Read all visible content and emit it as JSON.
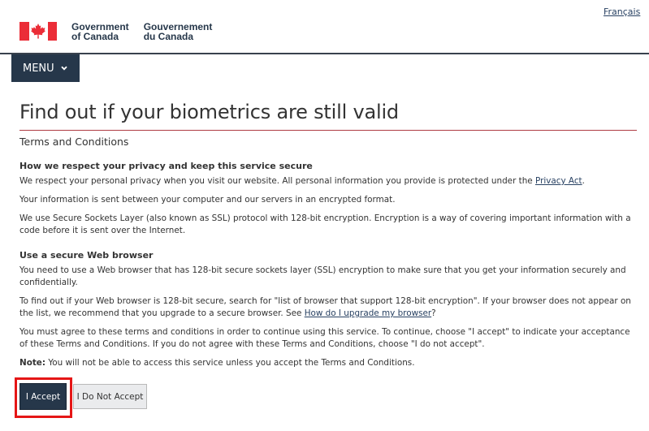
{
  "header": {
    "language_link": "Français",
    "signature": {
      "en_line1": "Government",
      "en_line2": "of Canada",
      "fr_line1": "Gouvernement",
      "fr_line2": "du Canada"
    },
    "menu_label": "MENU"
  },
  "main": {
    "title": "Find out if your biometrics are still valid",
    "section_heading": "Terms and Conditions",
    "privacy": {
      "heading": "How we respect your privacy and keep this service secure",
      "p1_pre": "We respect your personal privacy when you visit our website.  All personal information you provide is protected under the ",
      "p1_link": "Privacy Act",
      "p1_post": ".",
      "p2": "Your information is sent between your computer and our servers in an encrypted format.",
      "p3": "We use Secure Sockets Layer (also known as SSL) protocol with 128-bit encryption. Encryption is a way of covering important information with a code before it is sent over the Internet."
    },
    "browser": {
      "heading": "Use a secure Web browser",
      "p1": "You need to use a Web browser that has 128-bit secure sockets layer (SSL) encryption to make sure that you get your information securely and confidentially.",
      "p2_pre": "To find out if your Web browser is 128-bit secure, search for \"list of browser that support 128-bit encryption\". If your browser does not appear on the list, we recommend that you upgrade to a secure browser.  See ",
      "p2_link": "How do I upgrade my browser",
      "p2_post": "?",
      "p3": "You must agree to these terms and conditions in order to continue using this service. To continue, choose \"I accept\" to indicate your acceptance of these Terms and Conditions. If you do not agree with these Terms and Conditions, choose \"I do not accept\".",
      "note_label": "Note:",
      "note_text": " You will not be able to access this service unless you accept the Terms and Conditions."
    },
    "buttons": {
      "accept": "I Accept",
      "decline": "I Do Not Accept"
    }
  },
  "colors": {
    "gc_red": "#eb2d37",
    "navy": "#26374a",
    "link": "#284162",
    "title_rule": "#af3c43",
    "highlight": "#e51616"
  }
}
